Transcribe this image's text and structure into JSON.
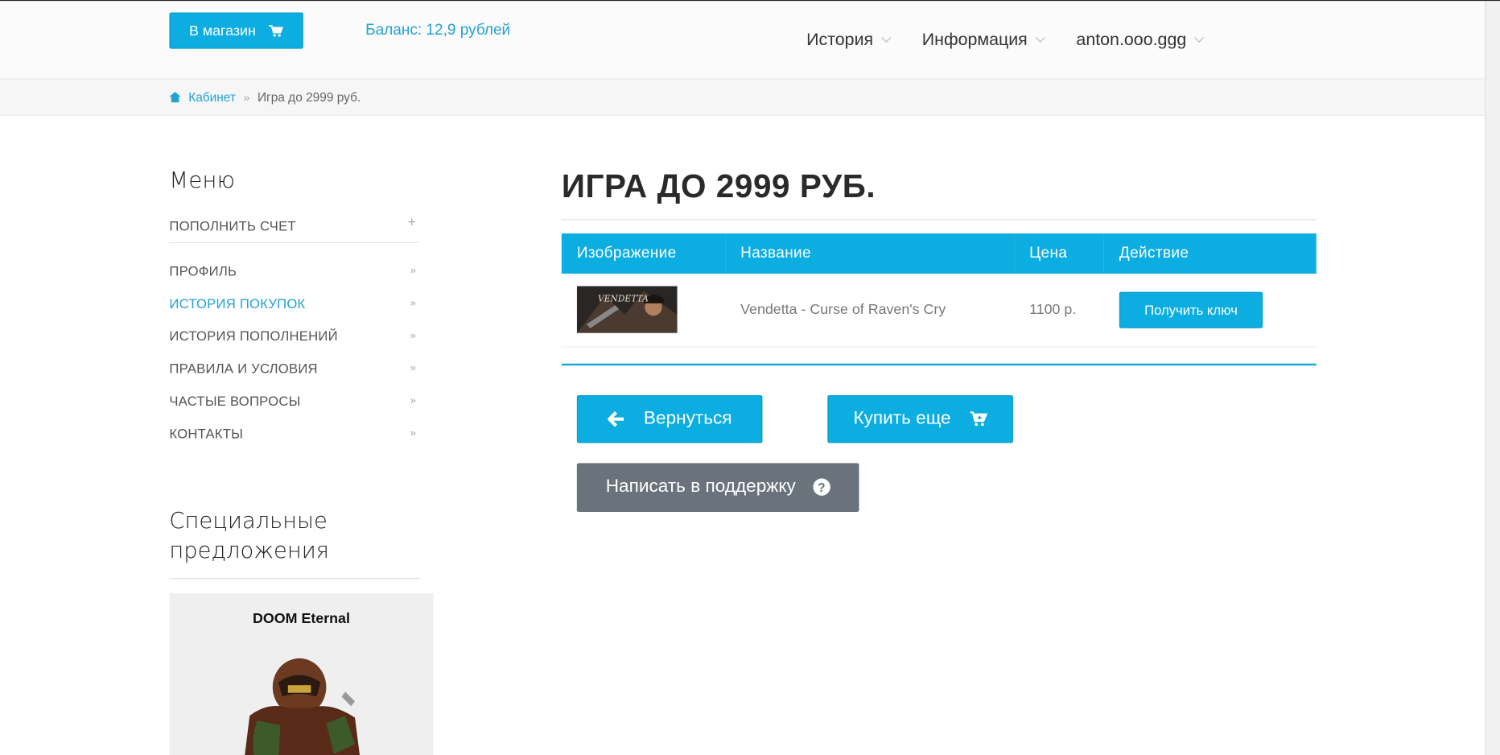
{
  "header": {
    "shop_button": "В магазин",
    "balance": "Баланс: 12,9 рублей",
    "nav": [
      "История",
      "Информация",
      "anton.ooo.ggg"
    ]
  },
  "breadcrumb": {
    "home": "Кабинет",
    "current": "Игра до 2999 руб."
  },
  "sidebar": {
    "menu_title": "Меню",
    "items": [
      {
        "label": "ПОПОЛНИТЬ СЧЕТ",
        "mark": "+"
      },
      {
        "label": "ПРОФИЛЬ",
        "mark": "»"
      },
      {
        "label": "ИСТОРИЯ ПОКУПОК",
        "mark": "»"
      },
      {
        "label": "ИСТОРИЯ ПОПОЛНЕНИЙ",
        "mark": "»"
      },
      {
        "label": "ПРАВИЛА И УСЛОВИЯ",
        "mark": "»"
      },
      {
        "label": "ЧАСТЫЕ ВОПРОСЫ",
        "mark": "»"
      },
      {
        "label": "КОНТАКТЫ",
        "mark": "»"
      }
    ],
    "special_title": "Специальные предложения",
    "promo_title": "DOOM Eternal"
  },
  "main": {
    "title": "ИГРА ДО 2999 РУБ.",
    "columns": [
      "Изображение",
      "Название",
      "Цена",
      "Действие"
    ],
    "rows": [
      {
        "thumb_text": "VENDETTA",
        "name": "Vendetta - Curse of Raven's Cry",
        "price": "1100 р.",
        "action": "Получить ключ"
      }
    ],
    "back_button": "Вернуться",
    "buy_more_button": "Купить еще",
    "support_button": "Написать в поддержку"
  },
  "colors": {
    "accent": "#0cade0",
    "link": "#20a3d4",
    "support": "#6a737b"
  }
}
